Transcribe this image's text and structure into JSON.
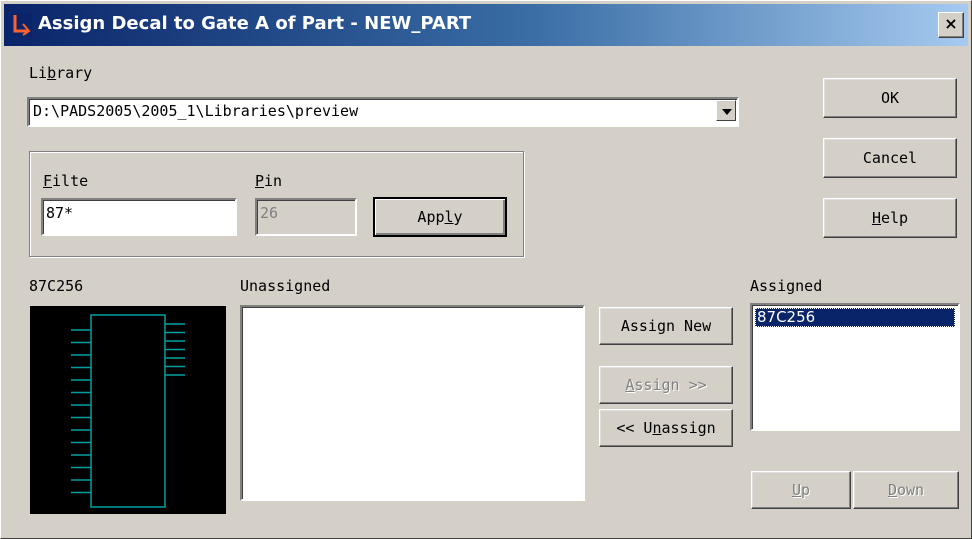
{
  "window": {
    "title": "Assign Decal to Gate A of Part - NEW_PART",
    "close_label": "×"
  },
  "library": {
    "label_pre": "Li",
    "label_u": "b",
    "label_post": "rary",
    "value": "D:\\PADS2005\\2005_1\\Libraries\\preview"
  },
  "filter": {
    "label_u": "F",
    "label_post": "ilte",
    "value": "87*"
  },
  "pin": {
    "label_u": "P",
    "label_post": "in",
    "value": "26"
  },
  "apply": {
    "pre": "App",
    "u": "l",
    "post": "y"
  },
  "buttons": {
    "ok": "OK",
    "cancel": "Cancel",
    "help_u": "H",
    "help_post": "elp"
  },
  "preview": {
    "label": "87C256"
  },
  "unassigned": {
    "label": "Unassigned",
    "items": []
  },
  "assigned": {
    "label": "Assigned",
    "items": [
      "87C256"
    ]
  },
  "assign_new": "Assign New",
  "assign": {
    "u": "A",
    "post": "ssign >>"
  },
  "unassign": {
    "pre": "<< U",
    "u": "n",
    "post": "assign"
  },
  "up": {
    "u": "U",
    "post": "p"
  },
  "down": {
    "u": "D",
    "post": "own"
  },
  "colors": {
    "title_bar": "#0a246a",
    "decal_outline": "#00a0a0",
    "preview_bg": "#000000",
    "dialog_bg": "#d4d0c8"
  }
}
